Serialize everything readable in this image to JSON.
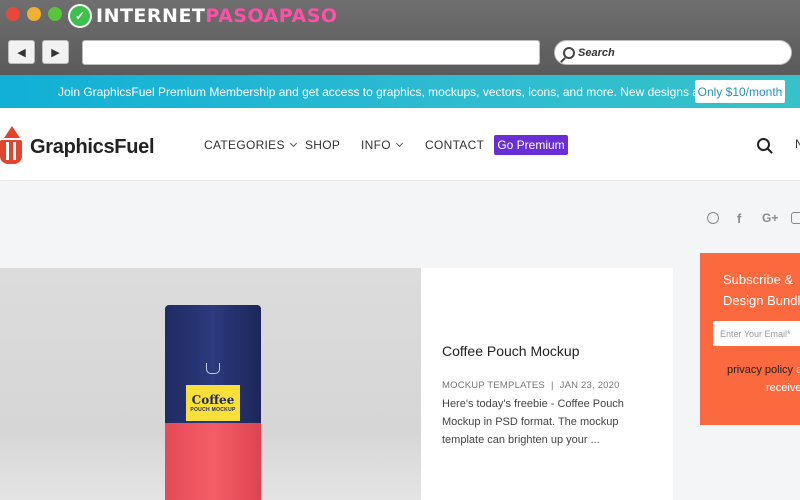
{
  "watermark": {
    "prefix": "INTERNET",
    "accent": "PASOAPASO",
    "badge": "✓"
  },
  "browser": {
    "back_icon": "back-arrow-icon",
    "forward_icon": "forward-arrow-icon",
    "back_glyph": "◀",
    "forward_glyph": "▶",
    "url_value": "",
    "search_placeholder": "Search"
  },
  "promo": {
    "text": "Join GraphicsFuel Premium Membership and get access to graphics, mockups, vectors, icons, and more. New designs added weekly!",
    "button": "Only $10/month"
  },
  "header": {
    "logo_text": "GraphicsFuel",
    "nav": [
      {
        "label": "CATEGORIES",
        "dropdown": true
      },
      {
        "label": "SHOP",
        "dropdown": false
      },
      {
        "label": "INFO",
        "dropdown": true
      },
      {
        "label": "CONTACT",
        "dropdown": false
      }
    ],
    "cta": "Go Premium",
    "edge_text": "N"
  },
  "social": {
    "icons": [
      "dribbble-icon",
      "facebook-icon",
      "google-plus-icon",
      "instagram-icon"
    ],
    "facebook": "f",
    "google": "G+"
  },
  "post": {
    "image_label_1": "Coffee",
    "image_label_2": "POUCH MOCKUP",
    "title": "Coffee Pouch Mockup",
    "category": "MOCKUP TEMPLATES",
    "separator": "|",
    "date": "JAN 23, 2020",
    "excerpt": "Here's today's freebie - Coffee Pouch Mockup in PSD format. The mockup template can brighten up your ..."
  },
  "subscribe": {
    "title_line1": "Subscribe &",
    "title_line2": "Design Bundle",
    "email_placeholder": "Enter Your Email*",
    "privacy": "privacy policy",
    "privacy_suffix": " ar",
    "receive": "receive"
  },
  "colors": {
    "accent_purple": "#6a2ed6",
    "promo_blue": "#11b0d6",
    "subscribe_orange": "#fb6a3e",
    "logo_red": "#e2442f"
  }
}
